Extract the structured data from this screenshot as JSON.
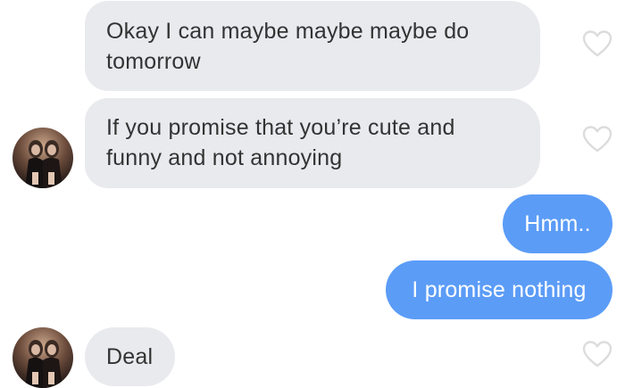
{
  "chat": {
    "messages": [
      {
        "sender": "match",
        "text": "Okay I can maybe maybe maybe do tomorrow",
        "line1": "Okay I can maybe maybe maybe do",
        "line2": "tomorrow"
      },
      {
        "sender": "match",
        "text": "If you promise that you’re cute and funny and not annoying",
        "line1": "If you promise that you’re cute and",
        "line2": "funny and not annoying"
      },
      {
        "sender": "me",
        "text": "Hmm.."
      },
      {
        "sender": "me",
        "text": "I promise nothing"
      },
      {
        "sender": "match",
        "text": "Deal"
      }
    ]
  },
  "icons": {
    "like": "heart-outline-icon",
    "avatar": "avatar-photo"
  },
  "colors": {
    "incoming_bubble": "#e9eaee",
    "outgoing_bubble": "#5b9cf7",
    "incoming_text": "#333333",
    "outgoing_text": "#ffffff",
    "heart_outline": "#dcdcdc"
  }
}
